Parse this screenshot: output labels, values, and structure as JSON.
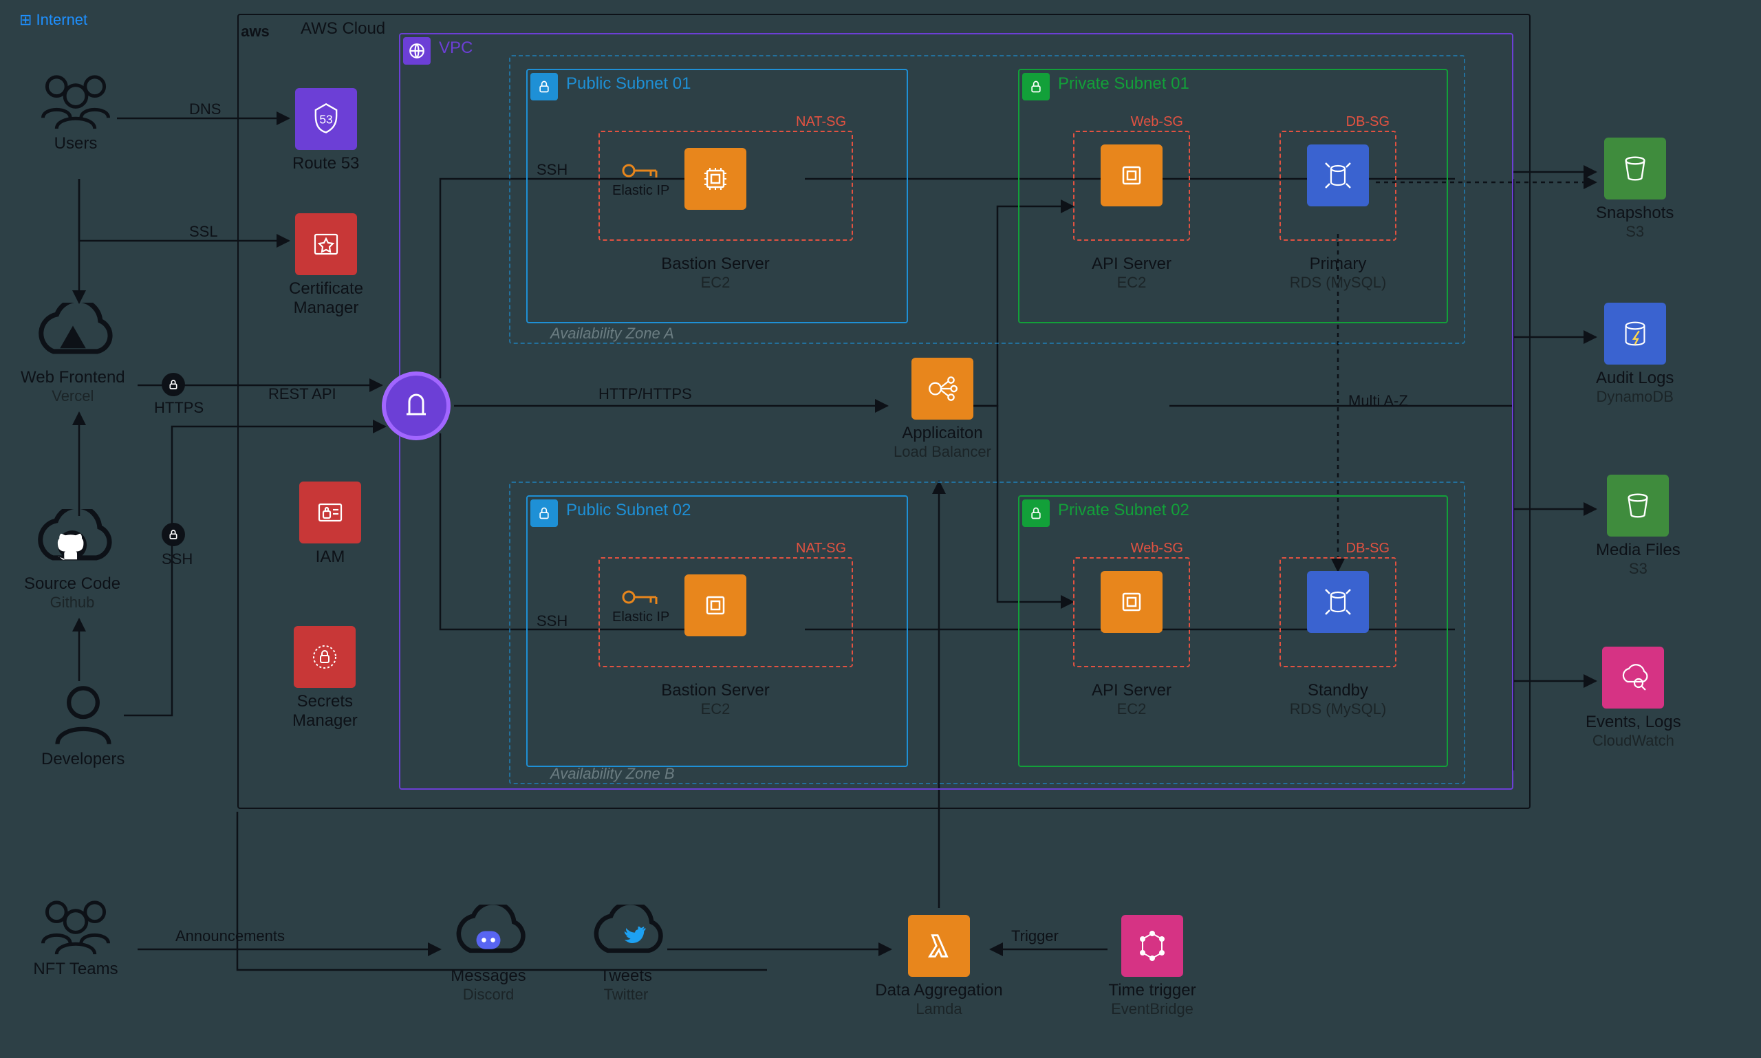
{
  "internet_label": "Internet",
  "aws_label": "AWS Cloud",
  "vpc_label": "VPC",
  "subnets": {
    "pub1": "Public Subnet 01",
    "pub2": "Public Subnet 02",
    "priv1": "Private Subnet 01",
    "priv2": "Private Subnet 02"
  },
  "sg": {
    "nat": "NAT-SG",
    "web": "Web-SG",
    "db": "DB-SG"
  },
  "az": {
    "a": "Availability Zone A",
    "b": "Availability Zone B"
  },
  "nodes": {
    "users": {
      "title": "Users",
      "sub": ""
    },
    "webfrontend": {
      "title": "Web Frontend",
      "sub": "Vercel"
    },
    "sourcecode": {
      "title": "Source Code",
      "sub": "Github"
    },
    "developers": {
      "title": "Developers",
      "sub": ""
    },
    "nftteams": {
      "title": "NFT Teams",
      "sub": ""
    },
    "route53": {
      "title": "Route 53",
      "sub": ""
    },
    "acm": {
      "title": "Certificate",
      "sub": "Manager"
    },
    "iam": {
      "title": "IAM",
      "sub": ""
    },
    "secrets": {
      "title": "Secrets",
      "sub": "Manager"
    },
    "igw": {
      "title": "",
      "sub": ""
    },
    "bastion1": {
      "title": "Bastion Server",
      "sub": "EC2"
    },
    "bastion2": {
      "title": "Bastion Server",
      "sub": "EC2"
    },
    "alb": {
      "title": "Applicaiton",
      "sub": "Load Balancer"
    },
    "api1": {
      "title": "API Server",
      "sub": "EC2"
    },
    "api2": {
      "title": "API Server",
      "sub": "EC2"
    },
    "rds1": {
      "title": "Primary",
      "sub": "RDS (MySQL)"
    },
    "rds2": {
      "title": "Standby",
      "sub": "RDS (MySQL)"
    },
    "snapshots": {
      "title": "Snapshots",
      "sub": "S3"
    },
    "auditlogs": {
      "title": "Audit Logs",
      "sub": "DynamoDB"
    },
    "mediafiles": {
      "title": "Media Files",
      "sub": "S3"
    },
    "eventslogs": {
      "title": "Events, Logs",
      "sub": "CloudWatch"
    },
    "discord": {
      "title": "Messages",
      "sub": "Discord"
    },
    "twitter": {
      "title": "Tweets",
      "sub": "Twitter"
    },
    "lambda": {
      "title": "Data Aggregation",
      "sub": "Lamda"
    },
    "eventbridge": {
      "title": "Time trigger",
      "sub": "EventBridge"
    }
  },
  "edges": {
    "dns": "DNS",
    "ssl": "SSL",
    "restapi": "REST API",
    "https": "HTTPS",
    "ssh": "SSH",
    "http": "HTTP/HTTPS",
    "multiaz": "Multi A-Z",
    "trigger": "Trigger",
    "announcements": "Announcements",
    "elasticip": "Elastic IP"
  }
}
